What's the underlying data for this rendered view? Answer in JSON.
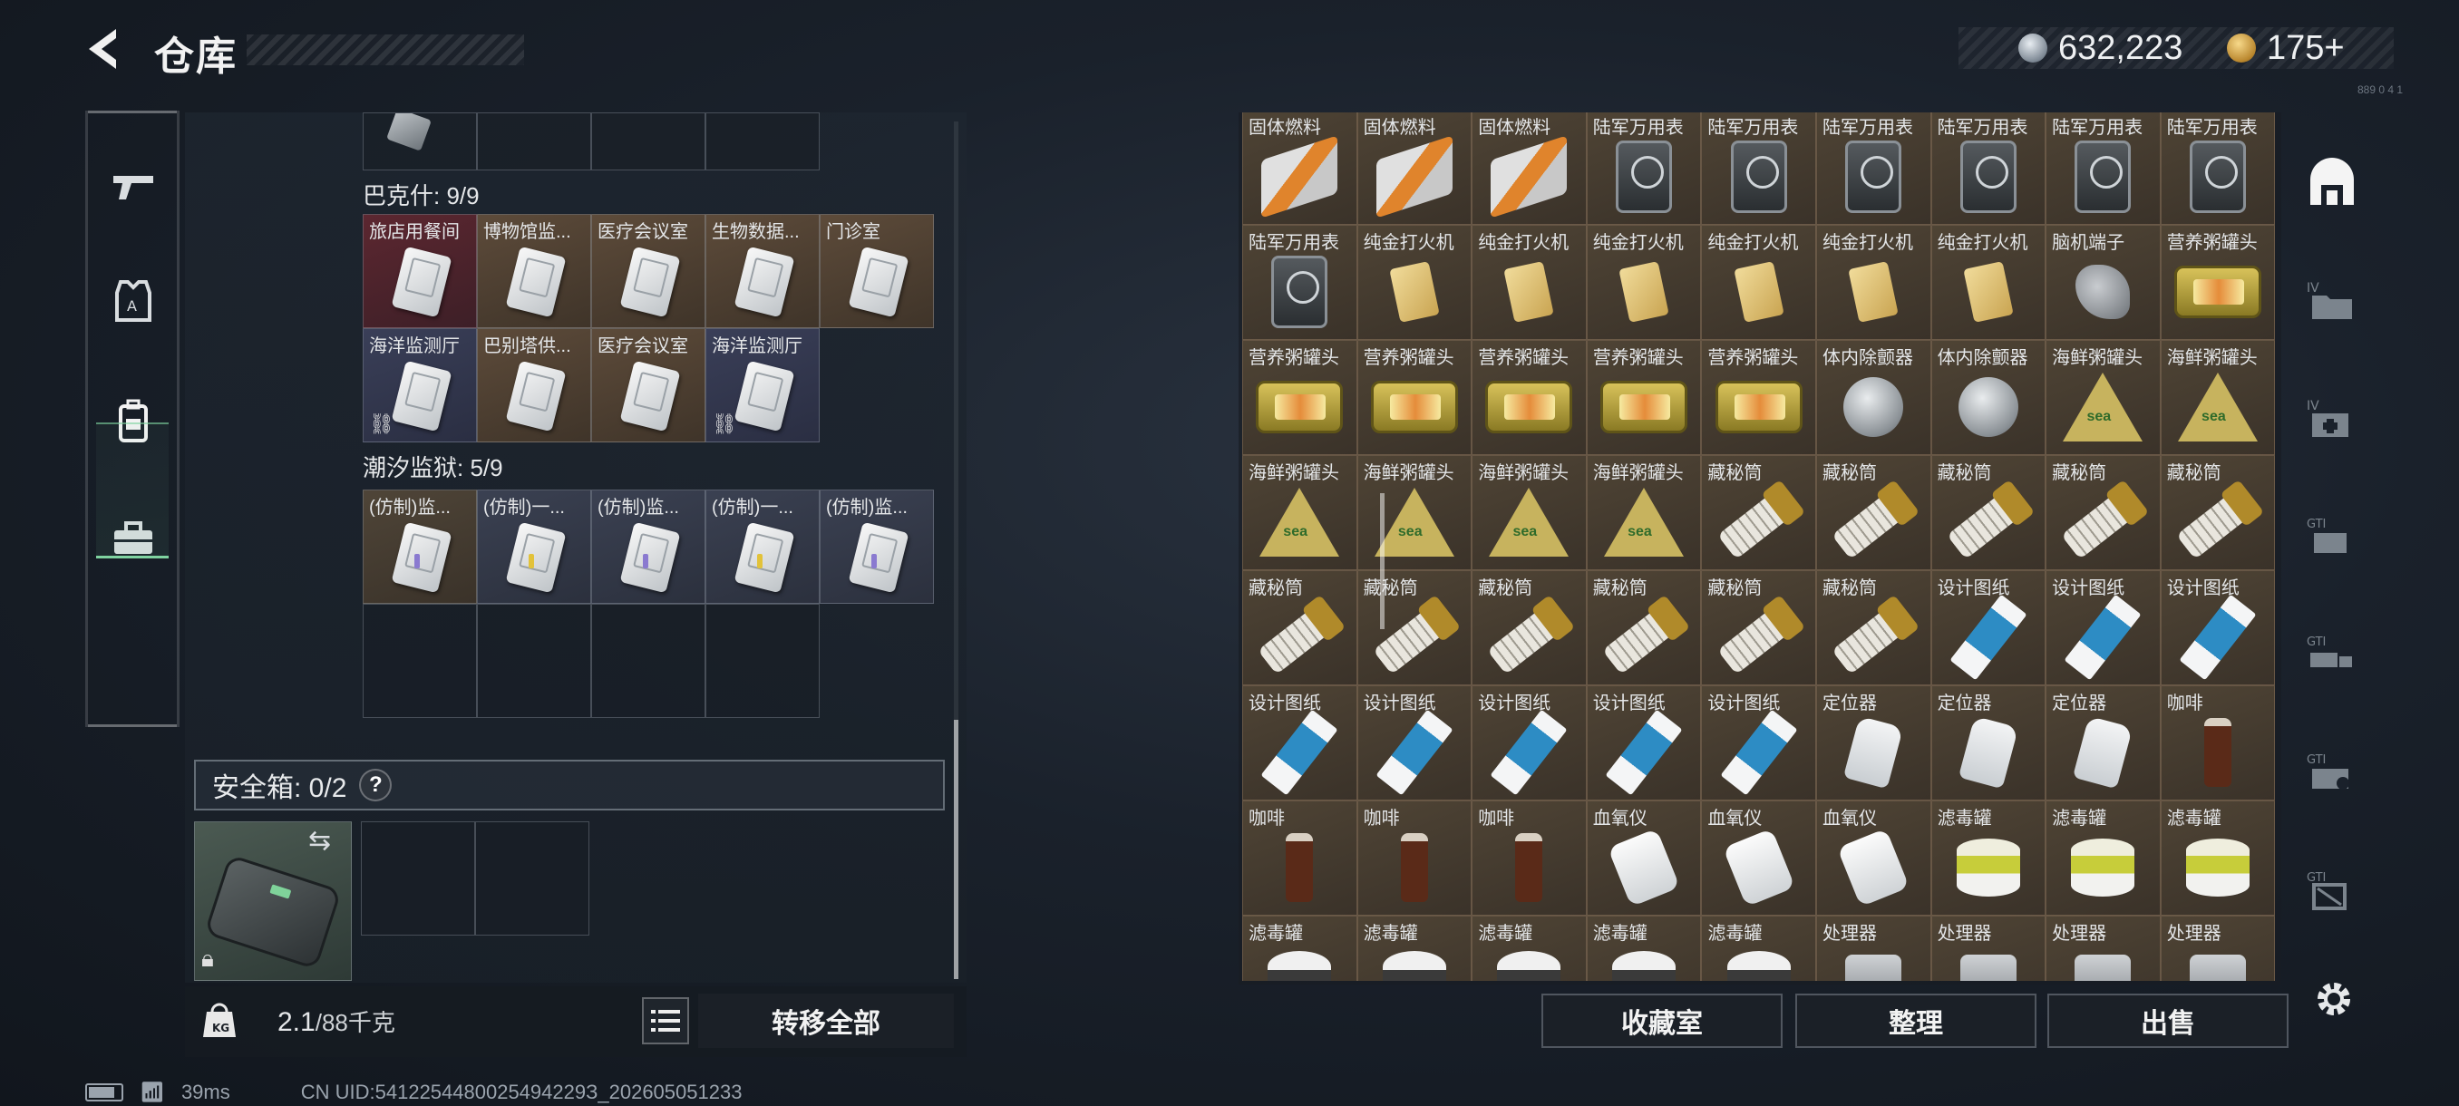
{
  "header": {
    "title": "仓库",
    "currency": {
      "silver": "632,223",
      "gold": "175+"
    },
    "tiny_label": "889 0 4 1"
  },
  "left_nav": {
    "items": [
      {
        "name": "weapon",
        "icon": "gun-icon"
      },
      {
        "name": "armor",
        "icon": "vest-icon"
      },
      {
        "name": "backpack",
        "icon": "backpack-icon",
        "active": true
      },
      {
        "name": "case",
        "icon": "toolbox-icon"
      }
    ]
  },
  "groups": {
    "bakshi": {
      "label": "巴克什: 9/9",
      "items": [
        "旅店用餐间",
        "博物馆监...",
        "医疗会议室",
        "生物数据...",
        "门诊室",
        "海洋监测厅",
        "巴别塔供...",
        "医疗会议室",
        "海洋监测厅"
      ]
    },
    "tidal": {
      "label": "潮汐监狱: 5/9",
      "items": [
        "(仿制)监...",
        "(仿制)一...",
        "(仿制)监...",
        "(仿制)一...",
        "(仿制)监..."
      ]
    }
  },
  "safe_box": {
    "label": "安全箱: 0/2",
    "help": "?"
  },
  "weight": {
    "value": "2.1",
    "unit": "/88千克"
  },
  "buttons": {
    "transfer_all": "转移全部",
    "collection": "收藏室",
    "organize": "整理",
    "sell": "出售"
  },
  "status": {
    "ping": "39ms",
    "uid": "CN UID:5412254480025494229З_202605051233"
  },
  "stash": {
    "items": [
      {
        "label": "固体燃料",
        "icon": "fuel"
      },
      {
        "label": "固体燃料",
        "icon": "fuel"
      },
      {
        "label": "固体燃料",
        "icon": "fuel"
      },
      {
        "label": "陆军万用表",
        "icon": "meter"
      },
      {
        "label": "陆军万用表",
        "icon": "meter"
      },
      {
        "label": "陆军万用表",
        "icon": "meter"
      },
      {
        "label": "陆军万用表",
        "icon": "meter"
      },
      {
        "label": "陆军万用表",
        "icon": "meter"
      },
      {
        "label": "陆军万用表",
        "icon": "meter"
      },
      {
        "label": "陆军万用表",
        "icon": "meter"
      },
      {
        "label": "纯金打火机",
        "icon": "lighter"
      },
      {
        "label": "纯金打火机",
        "icon": "lighter"
      },
      {
        "label": "纯金打火机",
        "icon": "lighter"
      },
      {
        "label": "纯金打火机",
        "icon": "lighter"
      },
      {
        "label": "纯金打火机",
        "icon": "lighter"
      },
      {
        "label": "纯金打火机",
        "icon": "lighter"
      },
      {
        "label": "脑机端子",
        "icon": "connector"
      },
      {
        "label": "营养粥罐头",
        "icon": "tin"
      },
      {
        "label": "营养粥罐头",
        "icon": "tin"
      },
      {
        "label": "营养粥罐头",
        "icon": "tin"
      },
      {
        "label": "营养粥罐头",
        "icon": "tin"
      },
      {
        "label": "营养粥罐头",
        "icon": "tin"
      },
      {
        "label": "营养粥罐头",
        "icon": "tin"
      },
      {
        "label": "体内除颤器",
        "icon": "disc"
      },
      {
        "label": "体内除颤器",
        "icon": "disc"
      },
      {
        "label": "海鲜粥罐头",
        "icon": "tri"
      },
      {
        "label": "海鲜粥罐头",
        "icon": "tri"
      },
      {
        "label": "海鲜粥罐头",
        "icon": "tri"
      },
      {
        "label": "海鲜粥罐头",
        "icon": "tri"
      },
      {
        "label": "海鲜粥罐头",
        "icon": "tri"
      },
      {
        "label": "海鲜粥罐头",
        "icon": "tri"
      },
      {
        "label": "藏秘筒",
        "icon": "tube"
      },
      {
        "label": "藏秘筒",
        "icon": "tube"
      },
      {
        "label": "藏秘筒",
        "icon": "tube"
      },
      {
        "label": "藏秘筒",
        "icon": "tube"
      },
      {
        "label": "藏秘筒",
        "icon": "tube"
      },
      {
        "label": "藏秘筒",
        "icon": "tube"
      },
      {
        "label": "藏秘筒",
        "icon": "tube"
      },
      {
        "label": "藏秘筒",
        "icon": "tube"
      },
      {
        "label": "藏秘筒",
        "icon": "tube"
      },
      {
        "label": "藏秘筒",
        "icon": "tube"
      },
      {
        "label": "藏秘筒",
        "icon": "tube"
      },
      {
        "label": "设计图纸",
        "icon": "blueprint"
      },
      {
        "label": "设计图纸",
        "icon": "blueprint"
      },
      {
        "label": "设计图纸",
        "icon": "blueprint"
      },
      {
        "label": "设计图纸",
        "icon": "blueprint"
      },
      {
        "label": "设计图纸",
        "icon": "blueprint"
      },
      {
        "label": "设计图纸",
        "icon": "blueprint"
      },
      {
        "label": "设计图纸",
        "icon": "blueprint"
      },
      {
        "label": "设计图纸",
        "icon": "blueprint"
      },
      {
        "label": "定位器",
        "icon": "locator"
      },
      {
        "label": "定位器",
        "icon": "locator"
      },
      {
        "label": "定位器",
        "icon": "locator"
      },
      {
        "label": "咖啡",
        "icon": "coffee"
      },
      {
        "label": "咖啡",
        "icon": "coffee"
      },
      {
        "label": "咖啡",
        "icon": "coffee"
      },
      {
        "label": "咖啡",
        "icon": "coffee"
      },
      {
        "label": "血氧仪",
        "icon": "oximeter"
      },
      {
        "label": "血氧仪",
        "icon": "oximeter"
      },
      {
        "label": "血氧仪",
        "icon": "oximeter"
      },
      {
        "label": "滤毒罐",
        "icon": "filter"
      },
      {
        "label": "滤毒罐",
        "icon": "filter"
      },
      {
        "label": "滤毒罐",
        "icon": "filter"
      },
      {
        "label": "滤毒罐",
        "icon": "canister"
      },
      {
        "label": "滤毒罐",
        "icon": "canister"
      },
      {
        "label": "滤毒罐",
        "icon": "canister"
      },
      {
        "label": "滤毒罐",
        "icon": "canister"
      },
      {
        "label": "滤毒罐",
        "icon": "canister"
      },
      {
        "label": "处理器",
        "icon": "processor"
      },
      {
        "label": "处理器",
        "icon": "processor"
      },
      {
        "label": "处理器",
        "icon": "processor"
      },
      {
        "label": "处理器",
        "icon": "processor"
      }
    ]
  },
  "right_nav": {
    "items": [
      "building-icon",
      "folder-iv-icon",
      "medkit-iv-icon",
      "gti-hand-icon",
      "gti-truck-icon",
      "gti-gear-icon",
      "gti-crate-icon"
    ]
  }
}
